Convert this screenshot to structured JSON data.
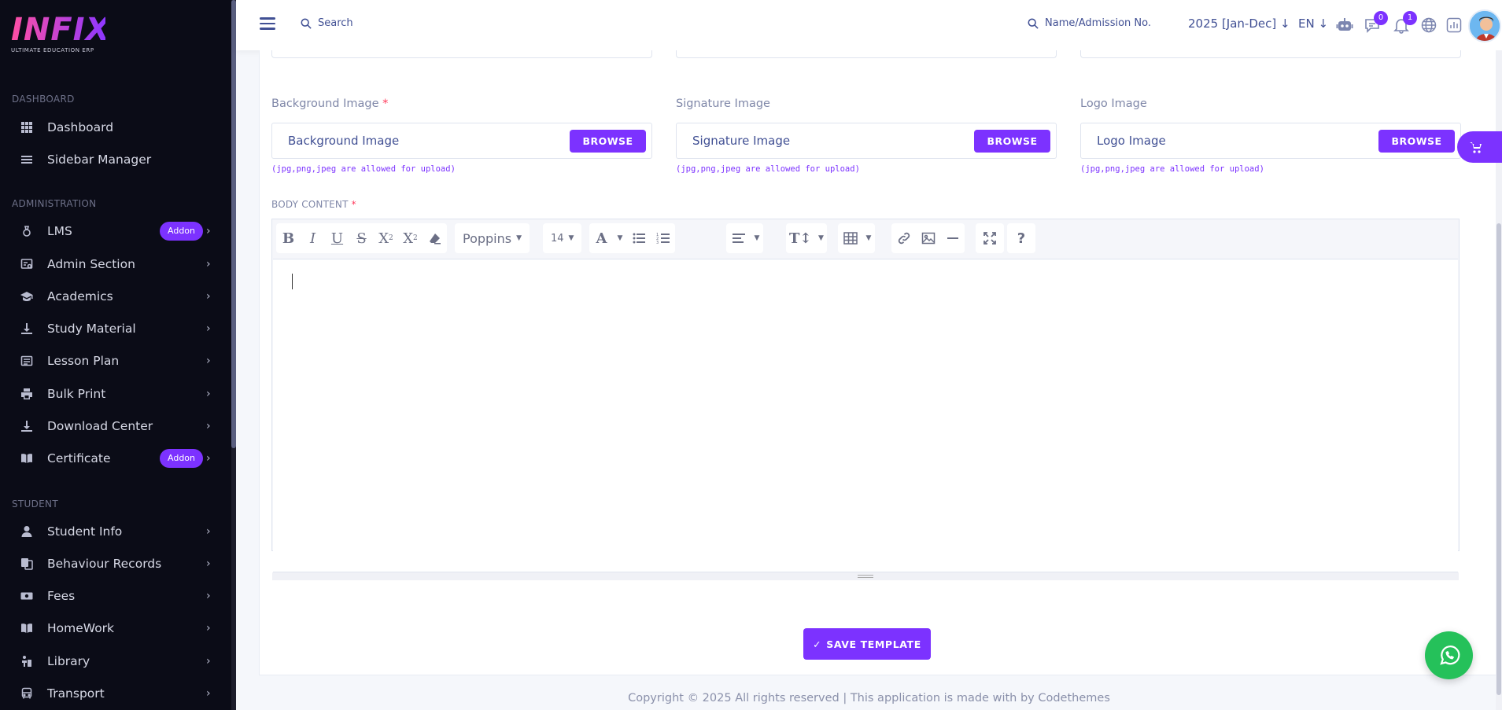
{
  "brand": {
    "name": "INFIX",
    "tagline": "ULTIMATE EDUCATION ERP"
  },
  "sidebar": {
    "sections": [
      {
        "label": "DASHBOARD",
        "items": [
          {
            "label": "Dashboard",
            "icon": "grid-icon"
          },
          {
            "label": "Sidebar Manager",
            "icon": "list-icon"
          }
        ]
      },
      {
        "label": "ADMINISTRATION",
        "items": [
          {
            "label": "LMS",
            "icon": "lms-icon",
            "badge": "Addon"
          },
          {
            "label": "Admin Section",
            "icon": "admin-icon"
          },
          {
            "label": "Academics",
            "icon": "graduation-cap-icon"
          },
          {
            "label": "Study Material",
            "icon": "download-icon"
          },
          {
            "label": "Lesson Plan",
            "icon": "lesson-icon"
          },
          {
            "label": "Bulk Print",
            "icon": "printer-icon"
          },
          {
            "label": "Download Center",
            "icon": "download-icon"
          },
          {
            "label": "Certificate",
            "icon": "book-icon",
            "badge": "Addon"
          }
        ]
      },
      {
        "label": "STUDENT",
        "items": [
          {
            "label": "Student Info",
            "icon": "user-icon"
          },
          {
            "label": "Behaviour Records",
            "icon": "records-icon"
          },
          {
            "label": "Fees",
            "icon": "money-icon"
          },
          {
            "label": "HomeWork",
            "icon": "book-icon"
          },
          {
            "label": "Library",
            "icon": "library-icon"
          },
          {
            "label": "Transport",
            "icon": "bus-icon"
          }
        ]
      }
    ]
  },
  "topbar": {
    "search_placeholder": "Search",
    "search2_placeholder": "Name/Admission No.",
    "session": "2025 [Jan-Dec]",
    "language": "EN",
    "chat_count": "0",
    "notification_count": "1"
  },
  "form": {
    "fields": [
      {
        "label": "Background Image",
        "placeholder": "Background Image",
        "button": "BROWSE",
        "hint": "(jpg,png,jpeg are allowed for upload)"
      },
      {
        "label": "Signature Image",
        "placeholder": "Signature Image",
        "button": "BROWSE",
        "hint": "(jpg,png,jpeg are allowed for upload)"
      },
      {
        "label": "Logo Image",
        "placeholder": "Logo Image",
        "button": "BROWSE",
        "hint": "(jpg,png,jpeg are allowed for upload)"
      }
    ],
    "required_mark": "*",
    "body_label": "BODY CONTENT",
    "editor": {
      "font": "Poppins",
      "size": "14"
    },
    "save_label": "SAVE TEMPLATE",
    "save_check": "✓"
  },
  "footer": {
    "text": "Copyright © 2025 All rights reserved | This application is made with by Codethemes"
  },
  "colors": {
    "accent": "#7c32ff",
    "sidebar_bg": "#0b0c17",
    "whatsapp": "#25c15a",
    "text": "#415094"
  }
}
